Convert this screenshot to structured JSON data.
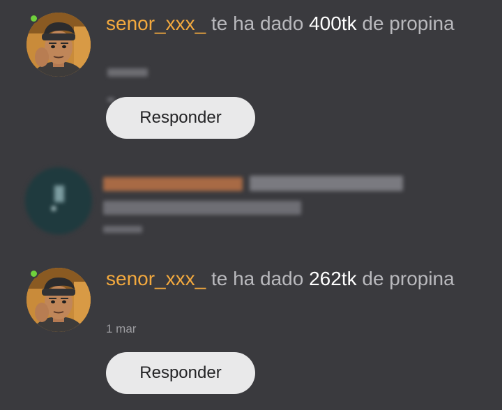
{
  "notifications": [
    {
      "username": "senor_xxx_",
      "text_before": " te ha dado ",
      "amount": "400tk",
      "text_after": " de propina",
      "date": "",
      "button_label": "Responder",
      "online": true
    },
    {
      "redacted": true
    },
    {
      "username": "senor_xxx_",
      "text_before": " te ha dado ",
      "amount": "262tk",
      "text_after": " de propina",
      "date": "1 mar",
      "button_label": "Responder",
      "online": true
    }
  ],
  "colors": {
    "background": "#3a3a3e",
    "username": "#f3a93e",
    "amount": "#ffffff",
    "body_text": "#b9b9bd",
    "button_bg": "#e9e9ea",
    "online": "#6fd13c"
  },
  "icons": {
    "online": "online-status-dot",
    "avatar": "user-avatar"
  }
}
